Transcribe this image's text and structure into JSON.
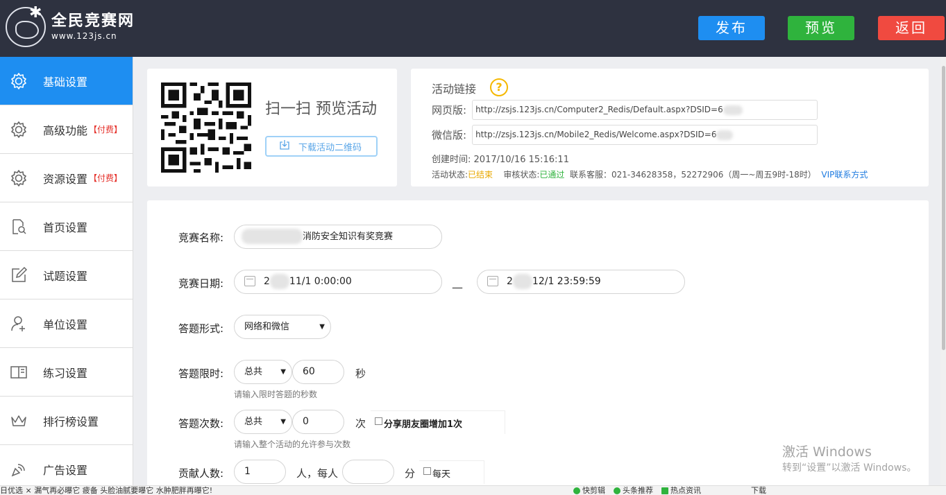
{
  "header": {
    "logo_title": "全民竞赛网",
    "logo_url": "www.123js.cn",
    "publish_label": "发布",
    "preview_label": "预览",
    "back_label": "返回"
  },
  "sidebar": {
    "items": [
      {
        "label": "基础设置",
        "tag": "",
        "icon": "gear-icon",
        "active": true
      },
      {
        "label": "高级功能",
        "tag": "【付费】",
        "icon": "gear-icon"
      },
      {
        "label": "资源设置",
        "tag": "【付费】",
        "icon": "gear-icon"
      },
      {
        "label": "首页设置",
        "tag": "",
        "icon": "page-search-icon"
      },
      {
        "label": "试题设置",
        "tag": "",
        "icon": "edit-icon"
      },
      {
        "label": "单位设置",
        "tag": "",
        "icon": "user-add-icon"
      },
      {
        "label": "练习设置",
        "tag": "",
        "icon": "book-icon"
      },
      {
        "label": "排行榜设置",
        "tag": "",
        "icon": "crown-icon"
      },
      {
        "label": "广告设置",
        "tag": "",
        "icon": "broadcast-icon"
      }
    ]
  },
  "qr_card": {
    "scan_text": "扫一扫 预览活动",
    "download_label": "下载活动二维码"
  },
  "link_card": {
    "title": "活动链接",
    "web_label": "网页版:",
    "web_url": "http://zsjs.123js.cn/Computer2_Redis/Default.aspx?DSID=6",
    "wechat_label": "微信版:",
    "wechat_url": "http://zsjs.123js.cn/Mobile2_Redis/Welcome.aspx?DSID=6",
    "created_label": "创建时间:",
    "created_value": "2017/10/16 15:16:11",
    "status_label": "活动状态:",
    "status_value": "已结束",
    "review_label": "审核状态:",
    "review_value": "已通过",
    "contact_text": "联系客服：021-34628358，52272906（周一~周五9时-18时）",
    "vip_link": "VIP联系方式"
  },
  "form": {
    "name_label": "竞赛名称:",
    "name_value": "消防安全知识有奖竞赛",
    "date_label": "竞赛日期:",
    "start_prefix": "2",
    "start_suffix": "11/1 0:00:00",
    "date_sep": "—",
    "end_prefix": "2",
    "end_suffix": "12/1 23:59:59",
    "mode_label": "答题形式:",
    "mode_value": "网络和微信",
    "time_label": "答题限时:",
    "time_scope": "总共",
    "time_value": "60",
    "time_unit": "秒",
    "time_hint": "请输入限时答题的秒数",
    "count_label": "答题次数:",
    "count_scope": "总共",
    "count_value": "0",
    "count_unit": "次",
    "share_label": "分享朋友圈增加1次",
    "count_hint": "请输入整个活动的允许参与次数",
    "contrib_label": "贡献人数:",
    "contrib_value": "1",
    "contrib_unit": "人，每人",
    "score_unit": "分",
    "daily_label": "每天"
  },
  "watermark": {
    "line1": "激活 Windows",
    "line2": "转到“设置”以激活 Windows。"
  },
  "statusbar": {
    "left_text": "日优选    ⨯ 漏气再必曝它  疲备  头脸油腻要曝它  水肿肥胖再曝它!",
    "items": [
      "快剪辑",
      "头条推荐",
      "热点资讯",
      "下载"
    ]
  }
}
